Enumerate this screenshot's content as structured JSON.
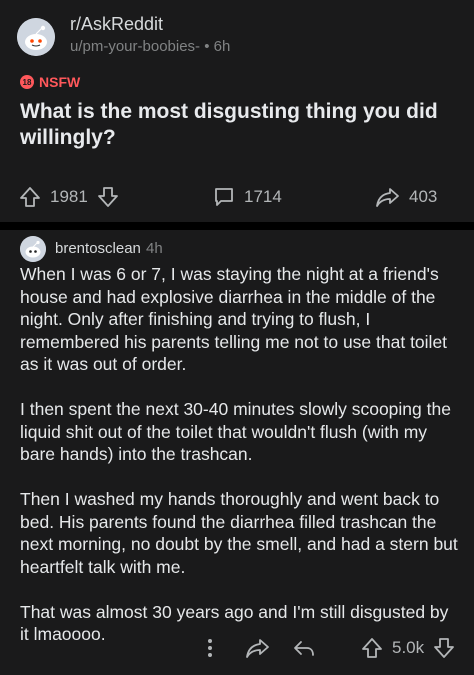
{
  "post": {
    "subreddit": "r/AskReddit",
    "meta": "u/pm-your-boobies- • 6h",
    "nsfw_label": "NSFW",
    "nsfw_badge": "18",
    "title": "What is the most disgusting thing you did willingly?",
    "upvotes": "1981",
    "comments": "1714",
    "shares": "403"
  },
  "comment": {
    "author": "brentosclean",
    "age": "4h",
    "paragraphs": [
      "When I was 6 or 7, I was staying the night at a friend's house and had explosive diarrhea in the middle of the night. Only after finishing and trying to flush, I remembered his parents telling me not to use that toilet as it was out of order.",
      "I then spent the next 30-40 minutes slowly scooping the liquid shit out of the toilet that wouldn't flush (with my bare hands) into the trashcan.",
      "Then I washed my hands thoroughly and went back to bed. His parents found the diarrhea filled trashcan the next morning, no doubt by the smell, and had a stern but heartfelt talk with me.",
      "That was almost 30 years ago and I'm still disgusted by it lmaoooo."
    ],
    "score": "5.0k"
  },
  "colors": {
    "background": "#1a1a1b",
    "page_bg": "#000000",
    "text": "#d7dadc",
    "muted": "#818384",
    "nsfw": "#ff585b"
  },
  "icons": [
    "snoo-avatar",
    "upvote-icon",
    "downvote-icon",
    "comment-icon",
    "share-icon",
    "more-icon",
    "reply-icon"
  ]
}
